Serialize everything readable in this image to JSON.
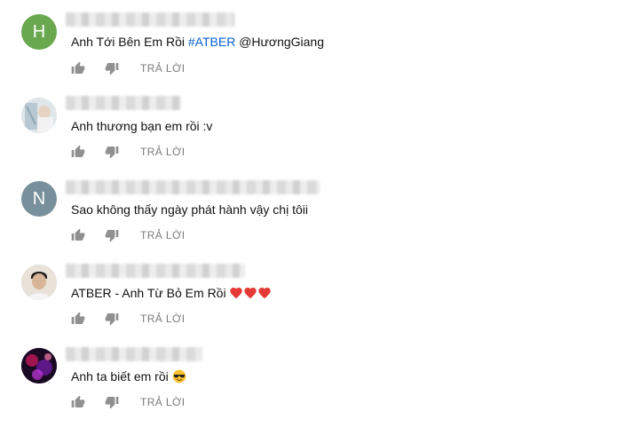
{
  "comments": [
    {
      "avatar_letter": "H",
      "avatar_color": "#6aa84f",
      "text_plain": "Anh Tới Bên Em Rồi ",
      "hashtag": "#ATBER",
      "mention": " @HươngGiang",
      "reply_label": "TRẢ LỜI"
    },
    {
      "avatar_letter": "",
      "avatar_color": "#c8d4dc",
      "text": "Anh thương bạn em rồi :v",
      "reply_label": "TRẢ LỜI"
    },
    {
      "avatar_letter": "N",
      "avatar_color": "#78909c",
      "text": "Sao không thấy ngày phát hành vậy chị tôii",
      "reply_label": "TRẢ LỜI"
    },
    {
      "avatar_letter": "",
      "avatar_color": "#d9d2c5",
      "text": "ATBER - Anh Từ Bỏ Em Rồi",
      "emoji": "red-heart ×3",
      "reply_label": "TRẢ LỜI"
    },
    {
      "avatar_letter": "",
      "avatar_color": "#2a0f3a",
      "text": "Anh ta biết em rồi",
      "emoji": "sunglasses-face",
      "reply_label": "TRẢ LỜI"
    }
  ],
  "colors": {
    "link_blue": "#065fd4",
    "icon_gray": "#909090",
    "reply_gray": "#7b7b7b",
    "text": "#111111"
  },
  "icons": [
    "thumb-up-icon",
    "thumb-down-icon",
    "heart-icon",
    "sunglasses-icon"
  ]
}
